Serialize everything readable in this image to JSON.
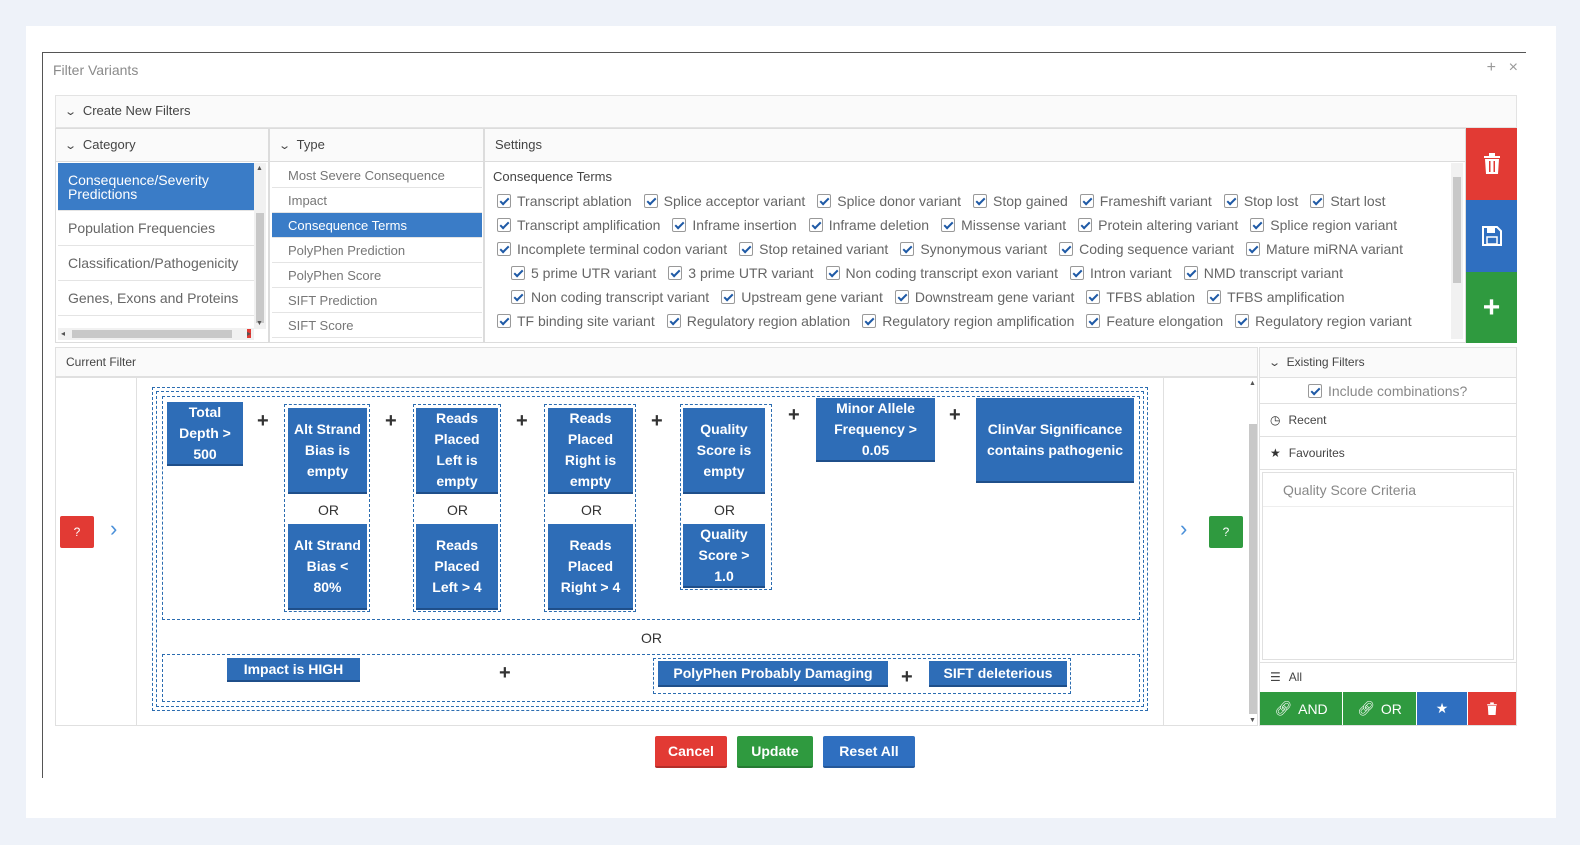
{
  "dialog": {
    "title": "Filter Variants",
    "plus_glyph": "+",
    "close_glyph": "×"
  },
  "create_new": {
    "label": "Create New Filters"
  },
  "category": {
    "header": "Category",
    "items": [
      "Consequence/Severity Predictions",
      "Population Frequencies",
      "Classification/Pathogenicity",
      "Genes, Exons and Proteins"
    ]
  },
  "type": {
    "header": "Type",
    "items": [
      "Most Severe Consequence",
      "Impact",
      "Consequence Terms",
      "PolyPhen Prediction",
      "PolyPhen Score",
      "SIFT Prediction",
      "SIFT Score"
    ]
  },
  "settings": {
    "header": "Settings",
    "terms_title": "Consequence Terms",
    "rows": [
      [
        "Transcript ablation",
        "Splice acceptor variant",
        "Splice donor variant",
        "Stop gained",
        "Frameshift variant",
        "Stop lost",
        "Start lost"
      ],
      [
        "Transcript amplification",
        "Inframe insertion",
        "Inframe deletion",
        "Missense variant",
        "Protein altering variant",
        "Splice region variant"
      ],
      [
        "Incomplete terminal codon variant",
        "Stop retained variant",
        "Synonymous variant",
        "Coding sequence variant",
        "Mature miRNA variant"
      ],
      [
        "5 prime UTR variant",
        "3 prime UTR variant",
        "Non coding transcript exon variant",
        "Intron variant",
        "NMD transcript variant"
      ],
      [
        "Non coding transcript variant",
        "Upstream gene variant",
        "Downstream gene variant",
        "TFBS ablation",
        "TFBS amplification"
      ],
      [
        "TF binding site variant",
        "Regulatory region ablation",
        "Regulatory region amplification",
        "Feature elongation",
        "Regulatory region variant"
      ]
    ]
  },
  "current_filter": {
    "header": "Current Filter",
    "help_glyph": "?",
    "arrow_glyph": "›",
    "plus": "+",
    "or": "OR",
    "chips": {
      "total_depth": "Total Depth > 500",
      "alt_bias_empty": "Alt Strand Bias is empty",
      "alt_bias_lt": "Alt Strand Bias < 80%",
      "reads_left_empty": "Reads Placed Left is empty",
      "reads_left_gt": "Reads Placed Left > 4",
      "reads_right_empty": "Reads Placed Right is empty",
      "reads_right_gt": "Reads Placed Right > 4",
      "quality_empty": "Quality Score is empty",
      "quality_gt": "Quality Score > 1.0",
      "maf": "Minor Allele Frequency > 0.05",
      "clinvar": "ClinVar Significance contains pathogenic",
      "impact_high": "Impact is HIGH",
      "polyphen": "PolyPhen Probably Damaging",
      "sift": "SIFT deleterious"
    }
  },
  "existing": {
    "header": "Existing Filters",
    "include_combos": "Include combinations?",
    "recent": "Recent",
    "favourites": "Favourites",
    "items": [
      "Quality Score Criteria"
    ],
    "all": "All",
    "and_label": "AND",
    "or_label": "OR"
  },
  "footer": {
    "cancel": "Cancel",
    "update": "Update",
    "reset": "Reset All"
  },
  "colors": {
    "primary": "#2f6fc0",
    "danger": "#e23a34",
    "success": "#2f9a3f"
  }
}
